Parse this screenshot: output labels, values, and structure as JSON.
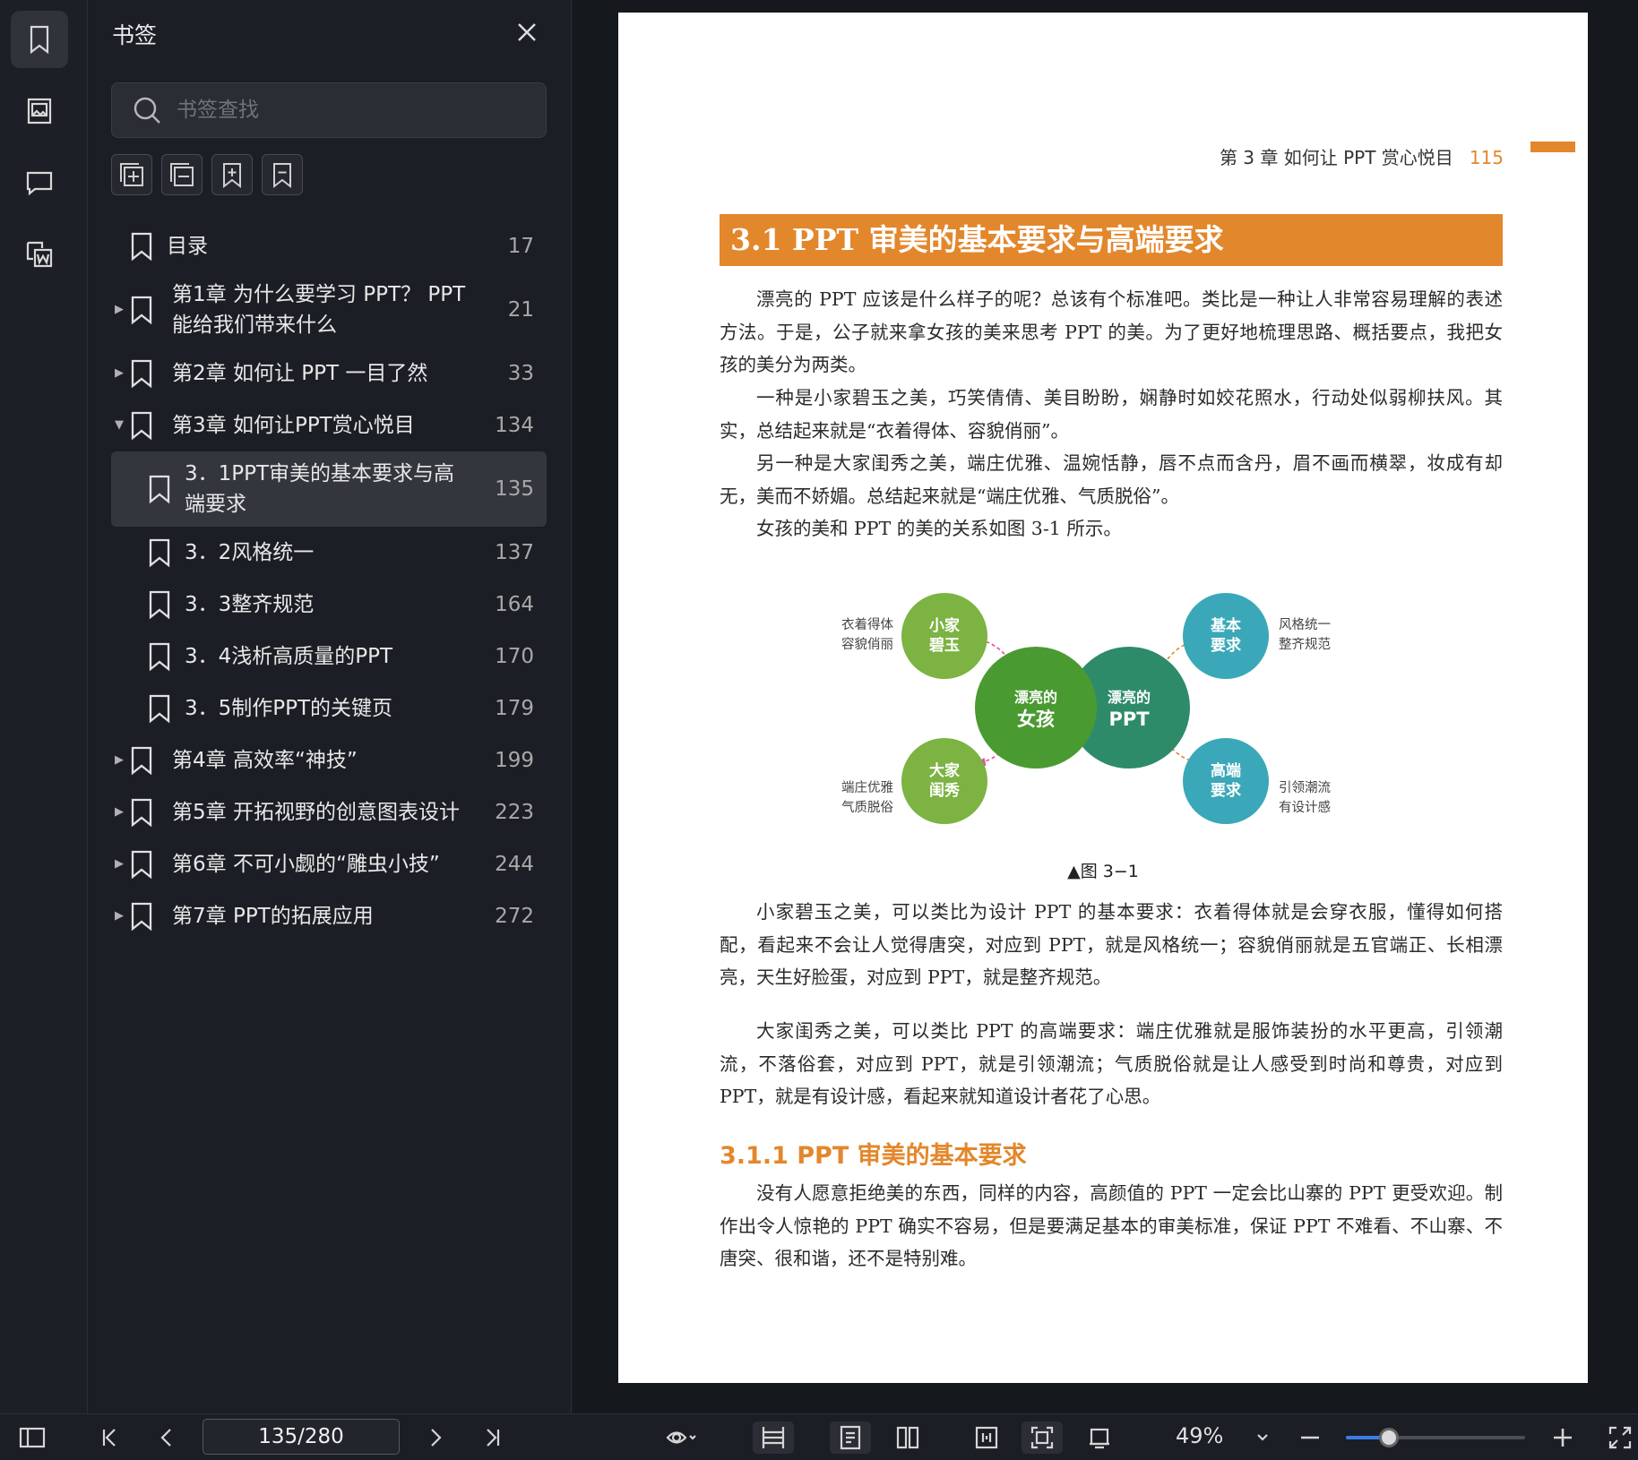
{
  "panel": {
    "title": "书签",
    "search_placeholder": "书签查找",
    "bookmarks": [
      {
        "label": "目录",
        "page": "17",
        "caret": "",
        "level": 0
      },
      {
        "label": "第1章 为什么要学习 PPT？ PPT\n能给我们带来什么",
        "page": "21",
        "caret": "▶",
        "level": 0
      },
      {
        "label": "第2章 如何让 PPT 一目了然",
        "page": "33",
        "caret": "▶",
        "level": 0
      },
      {
        "label": "第3章 如何让PPT赏心悦目",
        "page": "134",
        "caret": "▼",
        "level": 0
      },
      {
        "label": "3．1PPT审美的基本要求与高\n端要求",
        "page": "135",
        "caret": "",
        "level": 1,
        "selected": true
      },
      {
        "label": "3．2风格统一",
        "page": "137",
        "caret": "",
        "level": 1
      },
      {
        "label": "3．3整齐规范",
        "page": "164",
        "caret": "",
        "level": 1
      },
      {
        "label": "3．4浅析高质量的PPT",
        "page": "170",
        "caret": "",
        "level": 1
      },
      {
        "label": "3．5制作PPT的关键页",
        "page": "179",
        "caret": "",
        "level": 1
      },
      {
        "label": "第4章 高效率“神技”",
        "page": "199",
        "caret": "▶",
        "level": 0
      },
      {
        "label": "第5章 开拓视野的创意图表设计",
        "page": "223",
        "caret": "▶",
        "level": 0
      },
      {
        "label": "第6章 不可小觑的“雕虫小技”",
        "page": "244",
        "caret": "▶",
        "level": 0
      },
      {
        "label": "第7章 PPT的拓展应用",
        "page": "272",
        "caret": "▶",
        "level": 0
      }
    ]
  },
  "document": {
    "running_head": "第 3 章  如何让 PPT 赏心悦目",
    "page_number": "115",
    "section_title": "3.1  PPT 审美的基本要求与高端要求",
    "paragraphs": [
      "漂亮的 PPT 应该是什么样子的呢？总该有个标准吧。类比是一种让人非常容易理解的表述方法。于是，公子就来拿女孩的美来思考 PPT 的美。为了更好地梳理思路、概括要点，我把女孩的美分为两类。",
      "一种是小家碧玉之美，巧笑倩倩、美目盼盼，娴静时如姣花照水，行动处似弱柳扶风。其实，总结起来就是“衣着得体、容貌俏丽”。",
      "另一种是大家闺秀之美，端庄优雅、温婉恬静，唇不点而含丹，眉不画而横翠，妆成有却无，美而不娇媚。总结起来就是“端庄优雅、气质脱俗”。",
      "女孩的美和 PPT 的美的关系如图 3-1 所示。",
      "小家碧玉之美，可以类比为设计 PPT 的基本要求：衣着得体就是会穿衣服，懂得如何搭配，看起来不会让人觉得唐突，对应到 PPT，就是风格统一；容貌俏丽就是五官端正、长相漂亮，天生好脸蛋，对应到 PPT，就是整齐规范。",
      "大家闺秀之美，可以类比 PPT 的高端要求：端庄优雅就是服饰装扮的水平更高，引领潮流，不落俗套，对应到 PPT，就是引领潮流；气质脱俗就是让人感受到时尚和尊贵，对应到 PPT，就是有设计感，看起来就知道设计者花了心思。",
      "没有人愿意拒绝美的东西，同样的内容，高颜值的 PPT 一定会比山寨的 PPT 更受欢迎。制作出令人惊艳的 PPT 确实不容易，但是要满足基本的审美标准，保证 PPT 不难看、不山寨、不唐突、很和谐，还不是特别难。"
    ],
    "subsection_title": "3.1.1  PPT 审美的基本要求",
    "figure": {
      "caption": "▲图 3−1",
      "center_left": [
        "漂亮的",
        "女孩"
      ],
      "center_right": [
        "漂亮的",
        "PPT"
      ],
      "top_left_circle": [
        "小家",
        "碧玉"
      ],
      "top_left_text": [
        "衣着得体",
        "容貌俏丽"
      ],
      "bottom_left_circle": [
        "大家",
        "闺秀"
      ],
      "bottom_left_text": [
        "端庄优雅",
        "气质脱俗"
      ],
      "top_right_circle": [
        "基本",
        "要求"
      ],
      "top_right_text": [
        "风格统一",
        "整齐规范"
      ],
      "bottom_right_circle": [
        "高端",
        "要求"
      ],
      "bottom_right_text": [
        "引领潮流",
        "有设计感"
      ],
      "colors": {
        "light_green": "#7cb342",
        "dark_green": "#4a9a32",
        "teal_green": "#2e8b6a",
        "teal": "#3aa8b8"
      }
    }
  },
  "toolbar": {
    "page_indicator": "135/280",
    "zoom": "49%",
    "zoom_fraction": 0.24
  },
  "colors": {
    "accent": "#e3872c",
    "slider_fill": "#3d7ce8"
  }
}
